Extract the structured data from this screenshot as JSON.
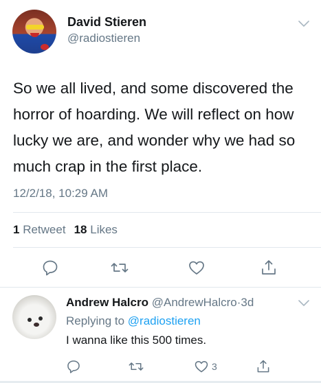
{
  "tweet": {
    "author_name": "David Stieren",
    "author_handle": "@radiostieren",
    "text": "So we all lived, and some discovered the horror of hoarding. We will reflect on how lucky we are, and wonder why we had so much crap in the first place.",
    "timestamp": "12/2/18, 10:29 AM",
    "retweet_count": "1",
    "retweet_label": "Retweet",
    "like_count": "18",
    "like_label": "Likes"
  },
  "reply": {
    "author_name": "Andrew Halcro",
    "author_handle": "@AndrewHalcro",
    "separator": "·",
    "age": "3d",
    "replying_prefix": "Replying to",
    "replying_to": "@radiostieren",
    "text": "I wanna like this 500 times.",
    "like_count": "3"
  },
  "colors": {
    "text": "#14171a",
    "secondary": "#657786",
    "link": "#1da1f2",
    "divider": "#e1e8ed"
  },
  "icons": {
    "menu": "chevron-down-icon",
    "reply": "reply-icon",
    "retweet": "retweet-icon",
    "like": "heart-icon",
    "share": "share-icon"
  }
}
